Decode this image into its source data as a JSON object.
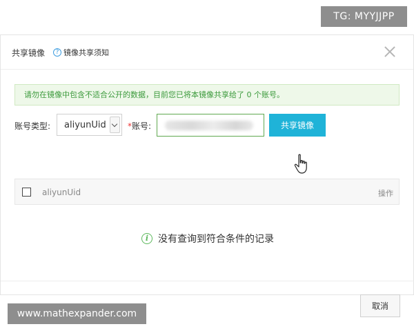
{
  "watermarks": {
    "top": "TG: MYYJJPP",
    "bottom": "www.mathexpander.com"
  },
  "dialog": {
    "title": "共享镜像",
    "help_link": "镜像共享须知",
    "help_icon": "?",
    "close_icon": "close-icon"
  },
  "notice": {
    "text": "请勿在镜像中包含不适合公开的数据，目前您已将本镜像共享给了 0 个账号。"
  },
  "form": {
    "account_type_label": "账号类型:",
    "account_type_value": "aliyunUid",
    "account_required_mark": "*",
    "account_label": "账号:",
    "account_value": "",
    "share_button": "共享镜像"
  },
  "table": {
    "columns": [
      "aliyunUid",
      "操作"
    ],
    "empty_icon": "i",
    "empty_text": "没有查询到符合条件的记录"
  },
  "footer": {
    "cancel_button": "取消"
  },
  "colors": {
    "primary_button": "#1fb3d8",
    "notice_text": "#3c9a3c",
    "notice_bg": "#eef8e9",
    "input_border_focus": "#5fa84f",
    "required": "#ee3333"
  }
}
